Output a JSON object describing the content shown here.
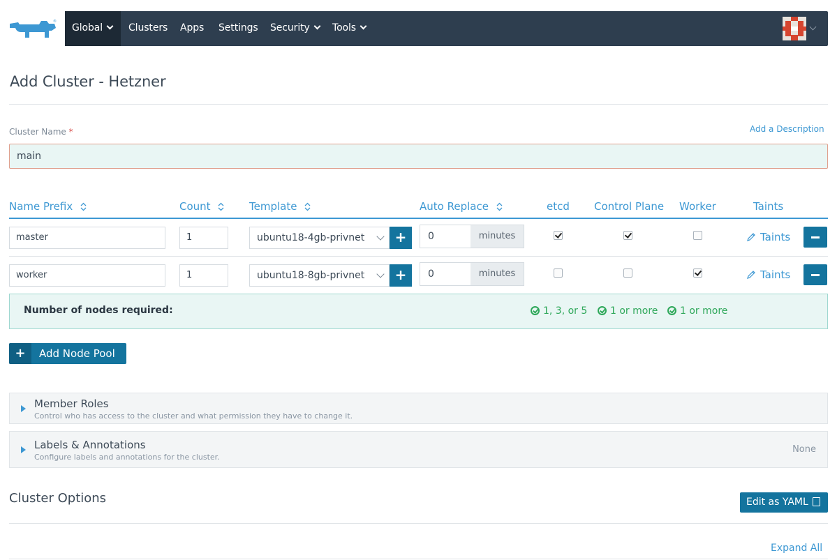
{
  "nav": {
    "items": [
      {
        "label": "Global",
        "dropdown": true,
        "active": true
      },
      {
        "label": "Clusters",
        "dropdown": false
      },
      {
        "label": "Apps",
        "dropdown": false
      },
      {
        "label": "Settings",
        "dropdown": false
      },
      {
        "label": "Security",
        "dropdown": true
      },
      {
        "label": "Tools",
        "dropdown": true
      }
    ],
    "logo_icon": "rancher-cow-logo-icon",
    "avatar_icon": "user-avatar-icon"
  },
  "page": {
    "title": "Add Cluster - Hetzner"
  },
  "cluster_name": {
    "label": "Cluster Name",
    "required_mark": "*",
    "value": "main",
    "add_description_link": "Add a Description"
  },
  "node_pools": {
    "headers": {
      "name_prefix": "Name Prefix",
      "count": "Count",
      "template": "Template",
      "auto_replace": "Auto Replace",
      "etcd": "etcd",
      "control_plane": "Control Plane",
      "worker": "Worker",
      "taints": "Taints"
    },
    "rows": [
      {
        "name_prefix": "master",
        "count": "1",
        "template": "ubuntu18-4gb-privnet",
        "auto_replace": "0",
        "unit": "minutes",
        "etcd": true,
        "control_plane": true,
        "worker": false,
        "taints_label": "Taints"
      },
      {
        "name_prefix": "worker",
        "count": "1",
        "template": "ubuntu18-8gb-privnet",
        "auto_replace": "0",
        "unit": "minutes",
        "etcd": false,
        "control_plane": false,
        "worker": true,
        "taints_label": "Taints"
      }
    ],
    "requirements": {
      "label": "Number of nodes required:",
      "etcd": "1, 3, or 5",
      "control_plane": "1 or more",
      "worker": "1 or more"
    },
    "add_pool_label": "Add Node Pool",
    "status_color": "#2fa85a"
  },
  "accordions": {
    "member_roles": {
      "title": "Member Roles",
      "subtitle": "Control who has access to the cluster and what permission they have to change it."
    },
    "labels": {
      "title": "Labels & Annotations",
      "subtitle": "Configure labels and annotations for the cluster.",
      "value": "None"
    }
  },
  "cluster_options": {
    "title": "Cluster Options",
    "edit_yaml_label": "Edit as YAML",
    "expand_all_label": "Expand All"
  },
  "colors": {
    "primary": "#14749e",
    "link": "#3d98d3",
    "nav_bg": "#2e3e4f"
  }
}
